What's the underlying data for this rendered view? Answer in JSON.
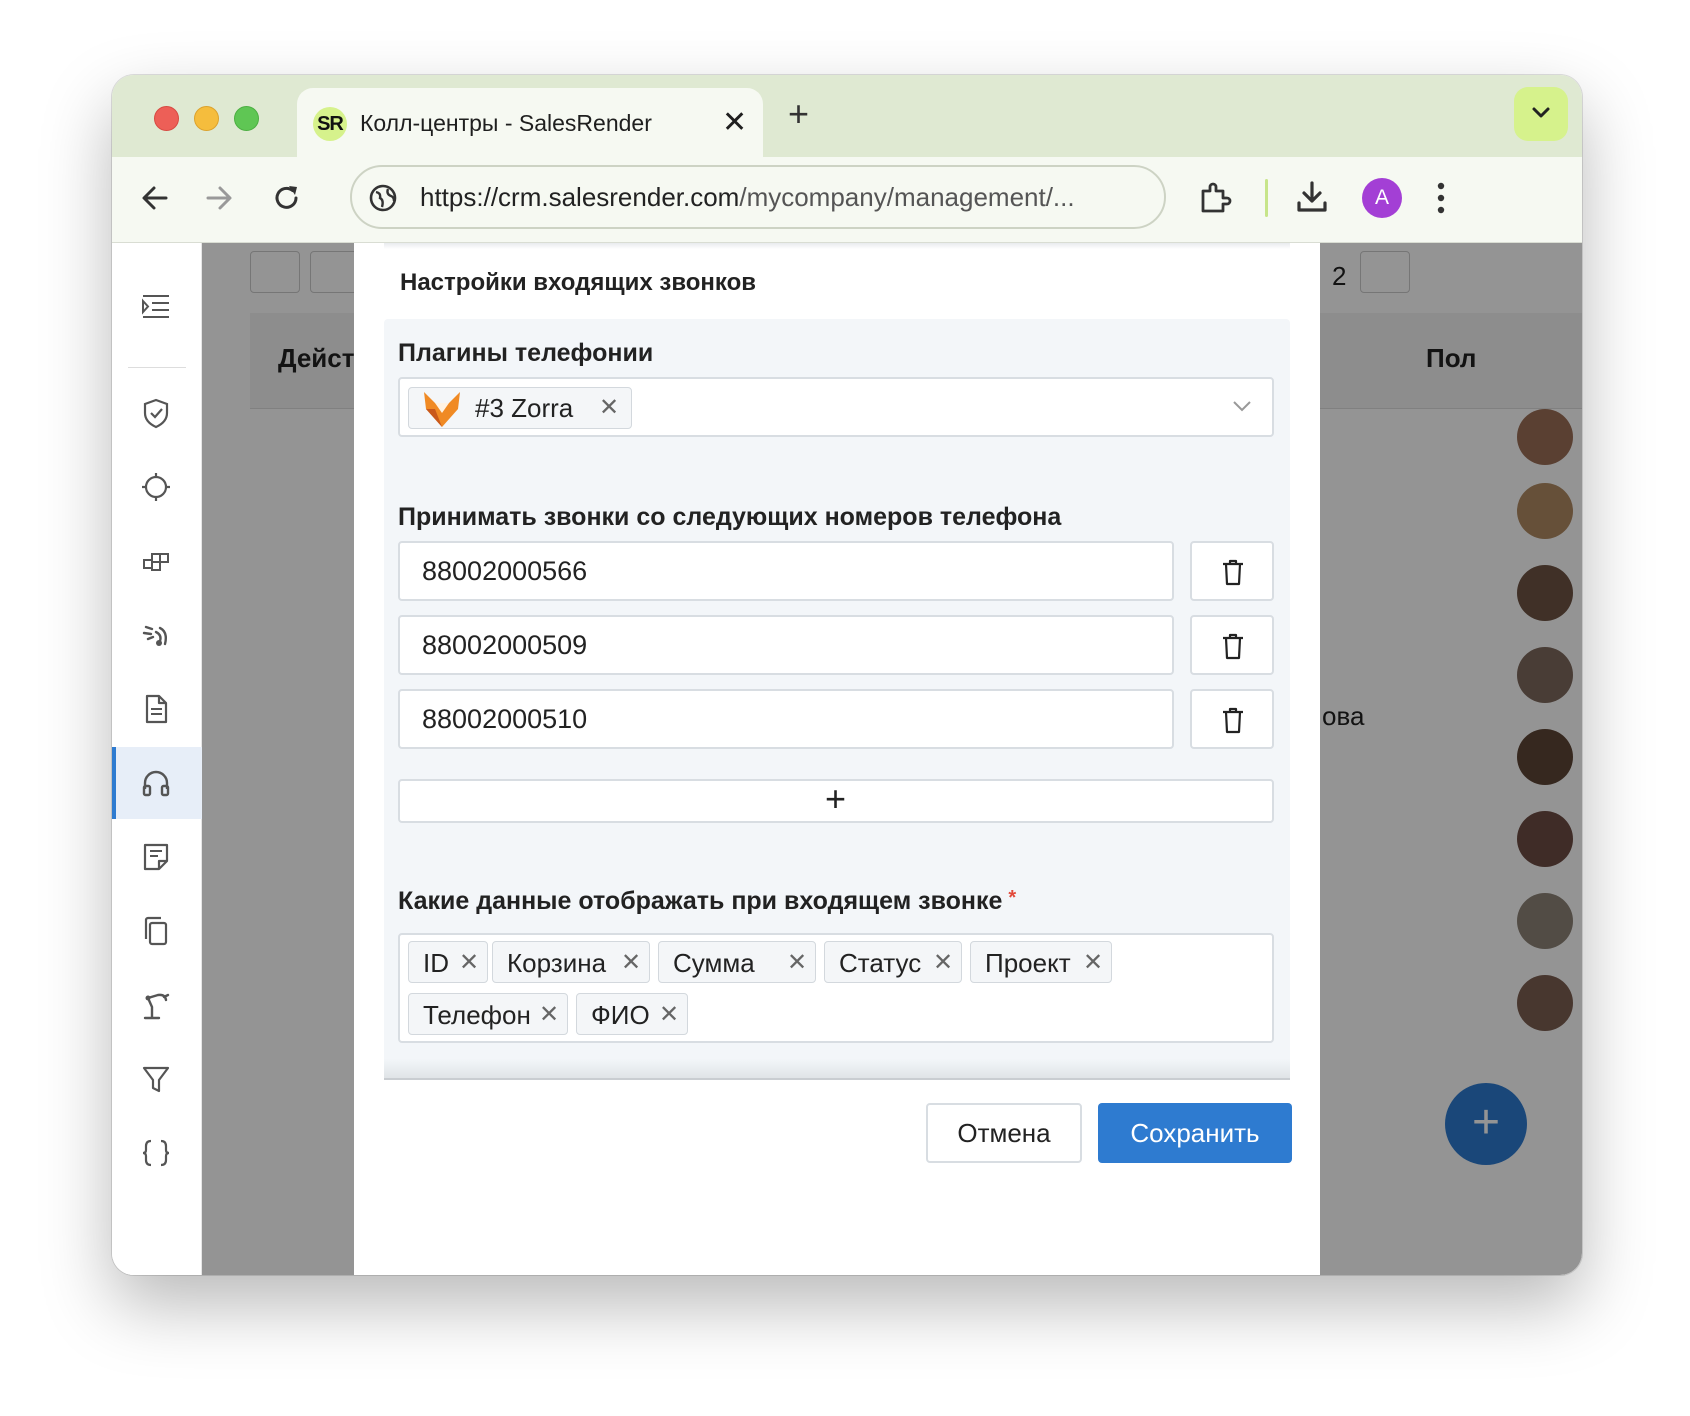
{
  "browser": {
    "tab_favicon": "SR",
    "tab_title": "Колл-центры - SalesRender",
    "tab_close": "✕",
    "new_tab": "+",
    "url_main": "https://crm.salesrender.com",
    "url_rest": "/mycompany/management/...",
    "profile_initial": "A"
  },
  "background": {
    "header_left": "Дейст",
    "header_right": "Пол",
    "page_count": "2",
    "row_text": "ова"
  },
  "modal": {
    "title": "Настройки входящих звонков",
    "plugins_label": "Плагины телефонии",
    "plugin_tag": "#3 Zorra",
    "plugin_tag_remove": "✕",
    "phones_label": "Принимать звонки со следующих номеров телефона",
    "phones": [
      "88002000566",
      "88002000509",
      "88002000510"
    ],
    "add_phone": "+",
    "display_label": "Какие данные отображать при входящем звонке",
    "required_mark": "*",
    "fields": [
      "ID",
      "Корзина",
      "Сумма",
      "Статус",
      "Проект",
      "Телефон",
      "ФИО"
    ],
    "chip_remove": "✕",
    "cancel_label": "Отмена",
    "save_label": "Сохранить"
  },
  "colors": {
    "accent": "#2e7bd0",
    "tab_accent": "#d6f28c",
    "required": "#e24a3b",
    "profile": "#a33fd5"
  },
  "icons": {
    "sidebar": [
      "menu-icon",
      "shield-check-icon",
      "crosshair-icon",
      "blocks-icon",
      "signal-icon",
      "document-icon",
      "headset-icon",
      "note-icon",
      "copy-icon",
      "robot-arm-icon",
      "funnel-icon",
      "braces-icon"
    ]
  }
}
